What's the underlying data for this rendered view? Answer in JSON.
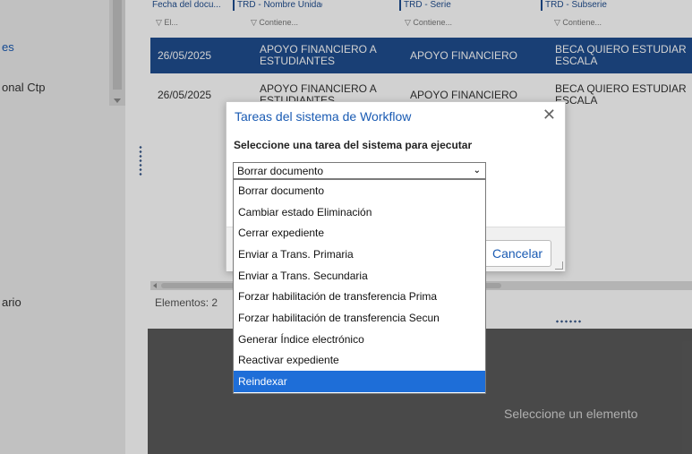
{
  "sidebar": {
    "items": [
      {
        "label": "es",
        "active": true
      },
      {
        "label": "onal Ctp",
        "active": false
      },
      {
        "label": "ario",
        "active": false
      }
    ]
  },
  "grid": {
    "columns": [
      {
        "header": "Fecha del docu...",
        "filter": "▽ El..."
      },
      {
        "header": "TRD - Nombre Unidad pr...",
        "filter": "▽ Contiene..."
      },
      {
        "header": "TRD - Serie",
        "filter": "▽ Contiene..."
      },
      {
        "header": "TRD - Subserie",
        "filter": "▽ Contiene..."
      }
    ],
    "rows": [
      {
        "date": "26/05/2025",
        "unit": "APOYO FINANCIERO A ESTUDIANTES",
        "series": "APOYO FINANCIERO",
        "subseries": "BECA QUIERO ESTUDIAR ESCALA",
        "selected": true
      },
      {
        "date": "26/05/2025",
        "unit": "APOYO FINANCIERO A ESTUDIANTES",
        "series": "APOYO FINANCIERO",
        "subseries": "BECA QUIERO ESTUDIAR ESCALA",
        "selected": false
      }
    ],
    "elements_count": "Elementos: 2"
  },
  "bottom_panel": {
    "message": "Seleccione un elemento"
  },
  "modal": {
    "title": "Tareas del sistema de Workflow",
    "close_glyph": "✕",
    "prompt": "Seleccione una tarea del sistema para ejecutar",
    "select_value": "Borrar documento",
    "cancel_label": "Cancelar",
    "options": [
      "Borrar documento",
      "Cambiar estado Eliminación",
      "Cerrar expediente",
      "Enviar a Trans. Primaria",
      "Enviar a Trans. Secundaria",
      "Forzar habilitación de transferencia Prima",
      "Forzar habilitación de transferencia Secun",
      "Generar Índice electrónico",
      "Reactivar expediente",
      "Reindexar"
    ],
    "highlighted_option": "Reindexar"
  },
  "colors": {
    "accent": "#1f4d8f",
    "highlight": "#1e6ed8",
    "link": "#1a5bb3",
    "panel": "#5a5a5a"
  }
}
